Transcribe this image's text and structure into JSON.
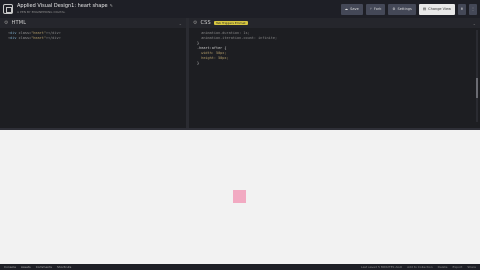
{
  "header": {
    "pen_title": "Applied Visual Design1: heart shape",
    "author_line": "A PEN BY ENGINEERING DIGITAL",
    "buttons": {
      "save": "Save",
      "fork": "Fork",
      "settings": "Settings",
      "change_view": "Change View"
    }
  },
  "html_editor": {
    "label": "HTML",
    "lines": [
      {
        "pre": "<",
        "tag": "div",
        "attr": " class=",
        "str": "\"heart\"",
        "post": "></div>"
      },
      {
        "pre": "<",
        "tag": "div",
        "attr": " class=",
        "str": "\"heart\"",
        "post": "></div>"
      }
    ]
  },
  "css_editor": {
    "label": "CSS",
    "badge": "Tab Triggers Emmet",
    "lines": [
      {
        "text": "  animation-duration: 1s;"
      },
      {
        "text": "  animation-iteration-count: infinite;"
      },
      {
        "text": "}"
      },
      {
        "text": ".heart:after {"
      },
      {
        "text": "  width: 50px;"
      },
      {
        "text": "  height: 50px;"
      },
      {
        "text": ""
      },
      {
        "text": "}"
      }
    ]
  },
  "preview": {
    "heart_color": "#f2aac2"
  },
  "footer": {
    "left_tabs": [
      "Console",
      "Assets",
      "Comments",
      "Shortcuts"
    ],
    "right_links": [
      "Last saved 5 MINUTES AGO",
      "Add to Collection",
      "Delete",
      "Export",
      "Share"
    ]
  }
}
